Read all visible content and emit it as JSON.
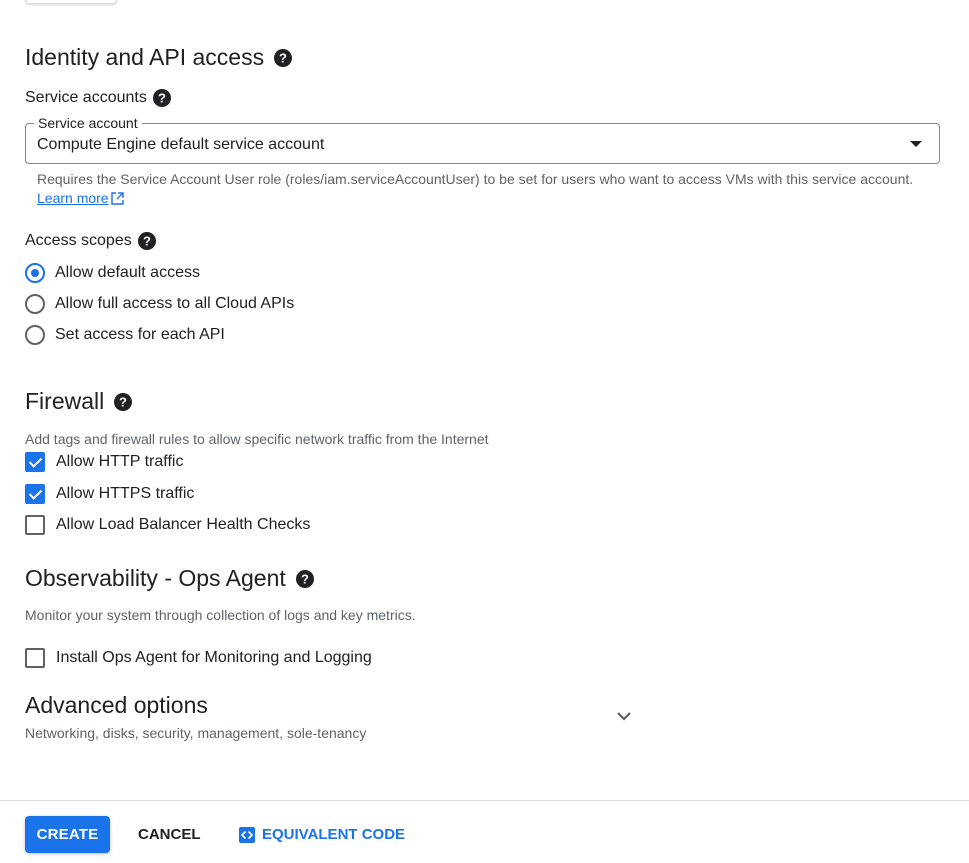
{
  "identity": {
    "title": "Identity and API access",
    "service_accounts_label": "Service accounts",
    "service_account_field": {
      "label": "Service account",
      "value": "Compute Engine default service account"
    },
    "hint_text": "Requires the Service Account User role (roles/iam.serviceAccountUser) to be set for users who want to access VMs with this service account.",
    "learn_more": "Learn more",
    "access_scopes_label": "Access scopes",
    "access_scopes": [
      {
        "label": "Allow default access",
        "selected": true
      },
      {
        "label": "Allow full access to all Cloud APIs",
        "selected": false
      },
      {
        "label": "Set access for each API",
        "selected": false
      }
    ]
  },
  "firewall": {
    "title": "Firewall",
    "description": "Add tags and firewall rules to allow specific network traffic from the Internet",
    "options": [
      {
        "label": "Allow HTTP traffic",
        "checked": true
      },
      {
        "label": "Allow HTTPS traffic",
        "checked": true
      },
      {
        "label": "Allow Load Balancer Health Checks",
        "checked": false
      }
    ]
  },
  "observability": {
    "title": "Observability - Ops Agent",
    "description": "Monitor your system through collection of logs and key metrics.",
    "option": {
      "label": "Install Ops Agent for Monitoring and Logging",
      "checked": false
    }
  },
  "advanced": {
    "title": "Advanced options",
    "description": "Networking, disks, security, management, sole-tenancy"
  },
  "footer": {
    "create": "CREATE",
    "cancel": "CANCEL",
    "equivalent_code": "EQUIVALENT CODE"
  },
  "colors": {
    "accent": "#1a73e8",
    "text": "#202124",
    "secondary_text": "#5f6368"
  },
  "icons": [
    "help-icon",
    "external-link-icon",
    "chevron-down-icon",
    "code-icon"
  ]
}
